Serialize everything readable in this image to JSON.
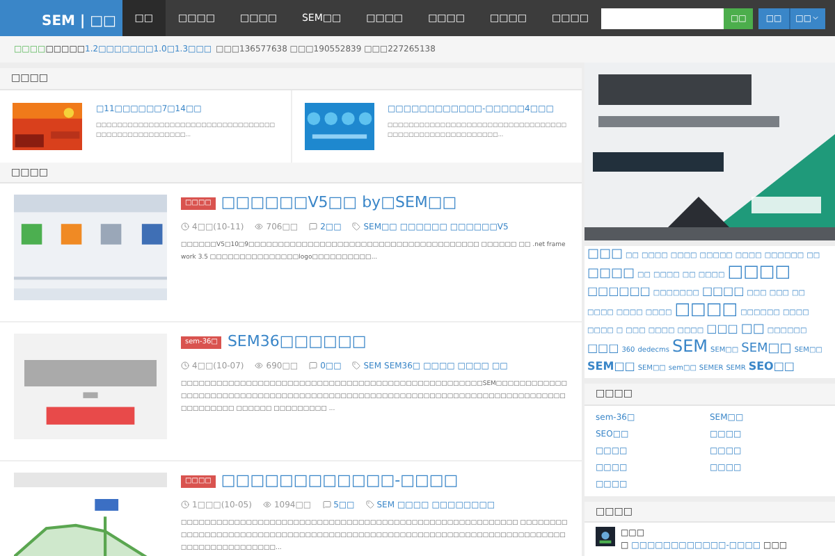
{
  "nav": {
    "logo": "SEM | □□",
    "items": [
      {
        "label": "□□",
        "selected": true
      },
      {
        "label": "□□□□",
        "selected": false
      },
      {
        "label": "□□□□",
        "selected": false
      },
      {
        "label": "SEM□□",
        "selected": false
      },
      {
        "label": "□□□□",
        "selected": false
      },
      {
        "label": "□□□□",
        "selected": false
      },
      {
        "label": "□□□□",
        "selected": false
      },
      {
        "label": "□□□□",
        "selected": false
      }
    ],
    "search_button": "□□",
    "login_button": "□□",
    "menu_button": "□□"
  },
  "notice": {
    "label": "□□□□",
    "text": "□□□□□",
    "link": "1.2□□□□□□□1.0□1.3□□□",
    "groups": "□□□136577638 □□□190552839 □□□227265138"
  },
  "featured": {
    "heading": "□□□□",
    "items": [
      {
        "title": "□11□□□□□□7□14□□",
        "excerpt": "□□□□□□□□□□□□□□□□□□□□□□□□□□□□□□□□□□□□□□□□□□□□□□□□□□□..."
      },
      {
        "title": "□□□□□□□□□□□□-□□□□□4□□□",
        "excerpt": "□□□□□□□□□□□□□□□□□□□□□□□□□□□□□□□□□□□□□□□□□□□□□□□□□□□□□□□..."
      }
    ]
  },
  "latest": {
    "heading": "□□□□",
    "articles": [
      {
        "badge": "□□□□",
        "title": "□□□□□□V5□□ by□SEM□□",
        "time": "4□□(10-11)",
        "views": "706□□",
        "comments": "2□□",
        "tags": [
          "SEM□□",
          "□□□□□□",
          "□□□□□□V5"
        ],
        "excerpt": "□□□□□□V5□10□9□□□□□□□□□□□□□□□□□□□□□□□□□□□□□□□□□□□□□□□ □□□□□□ □□ .net framework 3.5 □□□□□□□□□□□□□□□logo□□□□□□□□□□..."
      },
      {
        "badge": "sem-36□",
        "title": "SEM36□□□□□□",
        "time": "4□□(10-07)",
        "views": "690□□",
        "comments": "0□□",
        "tags": [
          "SEM",
          "SEM36□",
          "□□□□",
          "□□□□",
          "□□"
        ],
        "excerpt": "□□□□□□□□□□□□□□□□□□□□□□□□□□□□□□□□□□□□□□□□□□□□□□□□□□□SEM□□□□□□□□□□□□□□□□□□□□□□□□□□□□□□□□□□□□□□□□□□□□□□□□□□□□□□□□□□□□□□□□□□□□□□□□□□□□□□□□□□□□□□ □□□□□□ □□□□□□□□□ ..."
      },
      {
        "badge": "□□□□",
        "title": "□□□□□□□□□□□□-□□□□",
        "time": "1□□□(10-05)",
        "views": "1094□□",
        "comments": "5□□",
        "tags": [
          "SEM",
          "□□□□",
          "□□□□□□□□"
        ],
        "excerpt": "□□□□□□□□□□□□□□□□□□□□□□□□□□□□□□□□□□□□□□□□□□□□□□□□□□□□□□□□□ □□□□□□□□ □□□□□□□□□□□□□□□□□□□□□□□□□□□□□□□□□□□□□□□□□□□□□□□□□□□□□□□□□□□□□□□□□□□□□□□□□□□□□□□□□..."
      }
    ]
  },
  "tag_cloud": [
    {
      "text": "□□□",
      "kind": "l"
    },
    {
      "text": "□□",
      "kind": "s"
    },
    {
      "text": "□□□□",
      "kind": "s"
    },
    {
      "text": "□□□□",
      "kind": "s"
    },
    {
      "text": "□□□□□",
      "kind": "s"
    },
    {
      "text": "□□□□",
      "kind": "s"
    },
    {
      "text": "□□□□□□",
      "kind": "s"
    },
    {
      "text": "□□",
      "kind": "s"
    },
    {
      "text": "□□□□",
      "kind": "l"
    },
    {
      "text": "□□",
      "kind": "s"
    },
    {
      "text": "□□□□",
      "kind": "s"
    },
    {
      "text": "□□",
      "kind": "s"
    },
    {
      "text": "□□□□",
      "kind": "s"
    },
    {
      "text": "□□□□",
      "kind": "xl"
    },
    {
      "text": "□□□□□□",
      "kind": "m"
    },
    {
      "text": "□□□□□□□",
      "kind": "s"
    },
    {
      "text": "□□□□",
      "kind": "m"
    },
    {
      "text": "□□□",
      "kind": "s"
    },
    {
      "text": "□□□",
      "kind": "s"
    },
    {
      "text": "□□",
      "kind": "s"
    },
    {
      "text": "□□□□",
      "kind": "s"
    },
    {
      "text": "□□□□",
      "kind": "s"
    },
    {
      "text": "□□□□",
      "kind": "s"
    },
    {
      "text": "□□□□",
      "kind": "xl"
    },
    {
      "text": "□□□□□□",
      "kind": "s"
    },
    {
      "text": "□□□□",
      "kind": "s"
    },
    {
      "text": "□□□□",
      "kind": "s"
    },
    {
      "text": "□",
      "kind": "s"
    },
    {
      "text": "□□□",
      "kind": "s"
    },
    {
      "text": "□□□□",
      "kind": "s"
    },
    {
      "text": "□□□□",
      "kind": "s"
    },
    {
      "text": "□□□",
      "kind": "m"
    },
    {
      "text": "□□",
      "kind": "l"
    },
    {
      "text": "□□□□□□",
      "kind": "s"
    },
    {
      "text": "□□□",
      "kind": "m"
    },
    {
      "text": "360",
      "kind": "s"
    },
    {
      "text": "dedecms",
      "kind": "s"
    },
    {
      "text": "SEM",
      "kind": "xl"
    },
    {
      "text": "SEM□□",
      "kind": "s"
    },
    {
      "text": "SEM□□",
      "kind": "l"
    },
    {
      "text": "SEM□□",
      "kind": "s"
    },
    {
      "text": "SEM□□",
      "kind": "m"
    },
    {
      "text": "SEM□□",
      "kind": "s"
    },
    {
      "text": "sem□□",
      "kind": "s"
    },
    {
      "text": "SEMER",
      "kind": "s"
    },
    {
      "text": "SEMR",
      "kind": "s"
    },
    {
      "text": "SEO□□",
      "kind": "m"
    }
  ],
  "categories": {
    "heading": "□□□□",
    "items": [
      "sem-36□",
      "SEM□□",
      "SEO□□",
      "□□□□",
      "□□□□",
      "□□□□",
      "□□□□",
      "□□□□",
      "□□□□"
    ]
  },
  "comments": {
    "heading": "□□□□",
    "items": [
      {
        "author": "□□□",
        "prefix": "□",
        "link": "□□□□□□□□□□□□-□□□□",
        "suffix": "□□□"
      }
    ]
  }
}
